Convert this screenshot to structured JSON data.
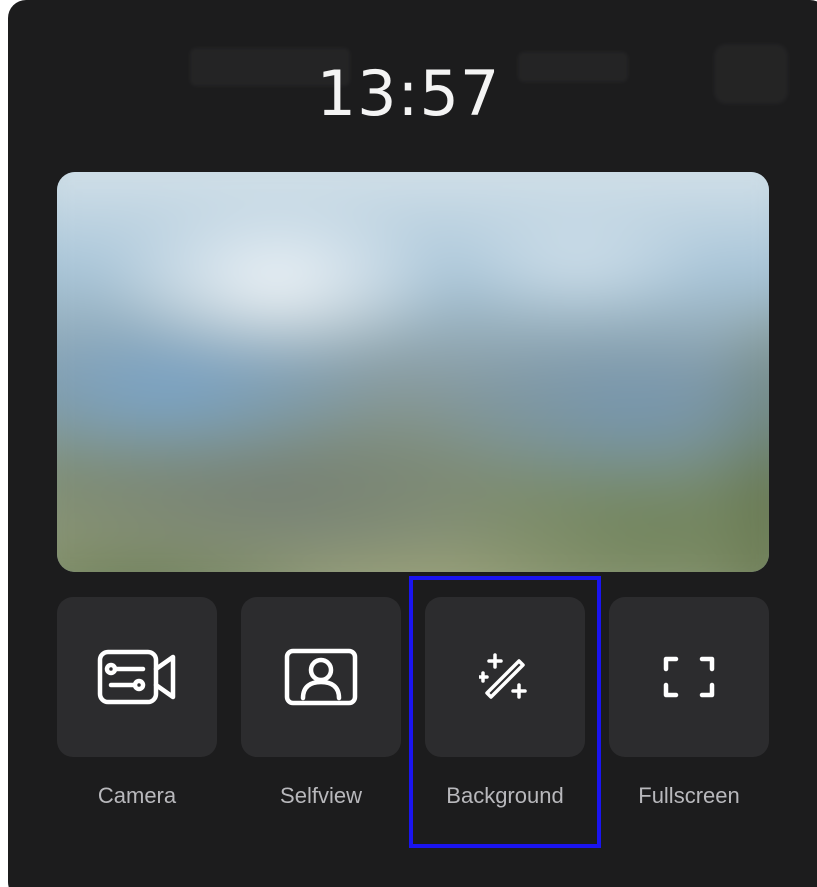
{
  "header": {
    "time": "13:57"
  },
  "preview": {
    "description_colors": {
      "sky": "#a7c4d8",
      "clouds": "#f4f7f9",
      "foliage": "#7f8e72"
    }
  },
  "controls": [
    {
      "label": "Camera",
      "icon": "camera-settings-icon"
    },
    {
      "label": "Selfview",
      "icon": "selfview-icon"
    },
    {
      "label": "Background",
      "icon": "magic-wand-icon"
    },
    {
      "label": "Fullscreen",
      "icon": "fullscreen-icon"
    }
  ],
  "highlight": {
    "target": "Background",
    "color": "#1a14f0"
  },
  "colors": {
    "panel": "#1c1c1d",
    "tile": "#2c2c2e",
    "label": "#b8b8bc",
    "clock": "#f4f4f4"
  }
}
